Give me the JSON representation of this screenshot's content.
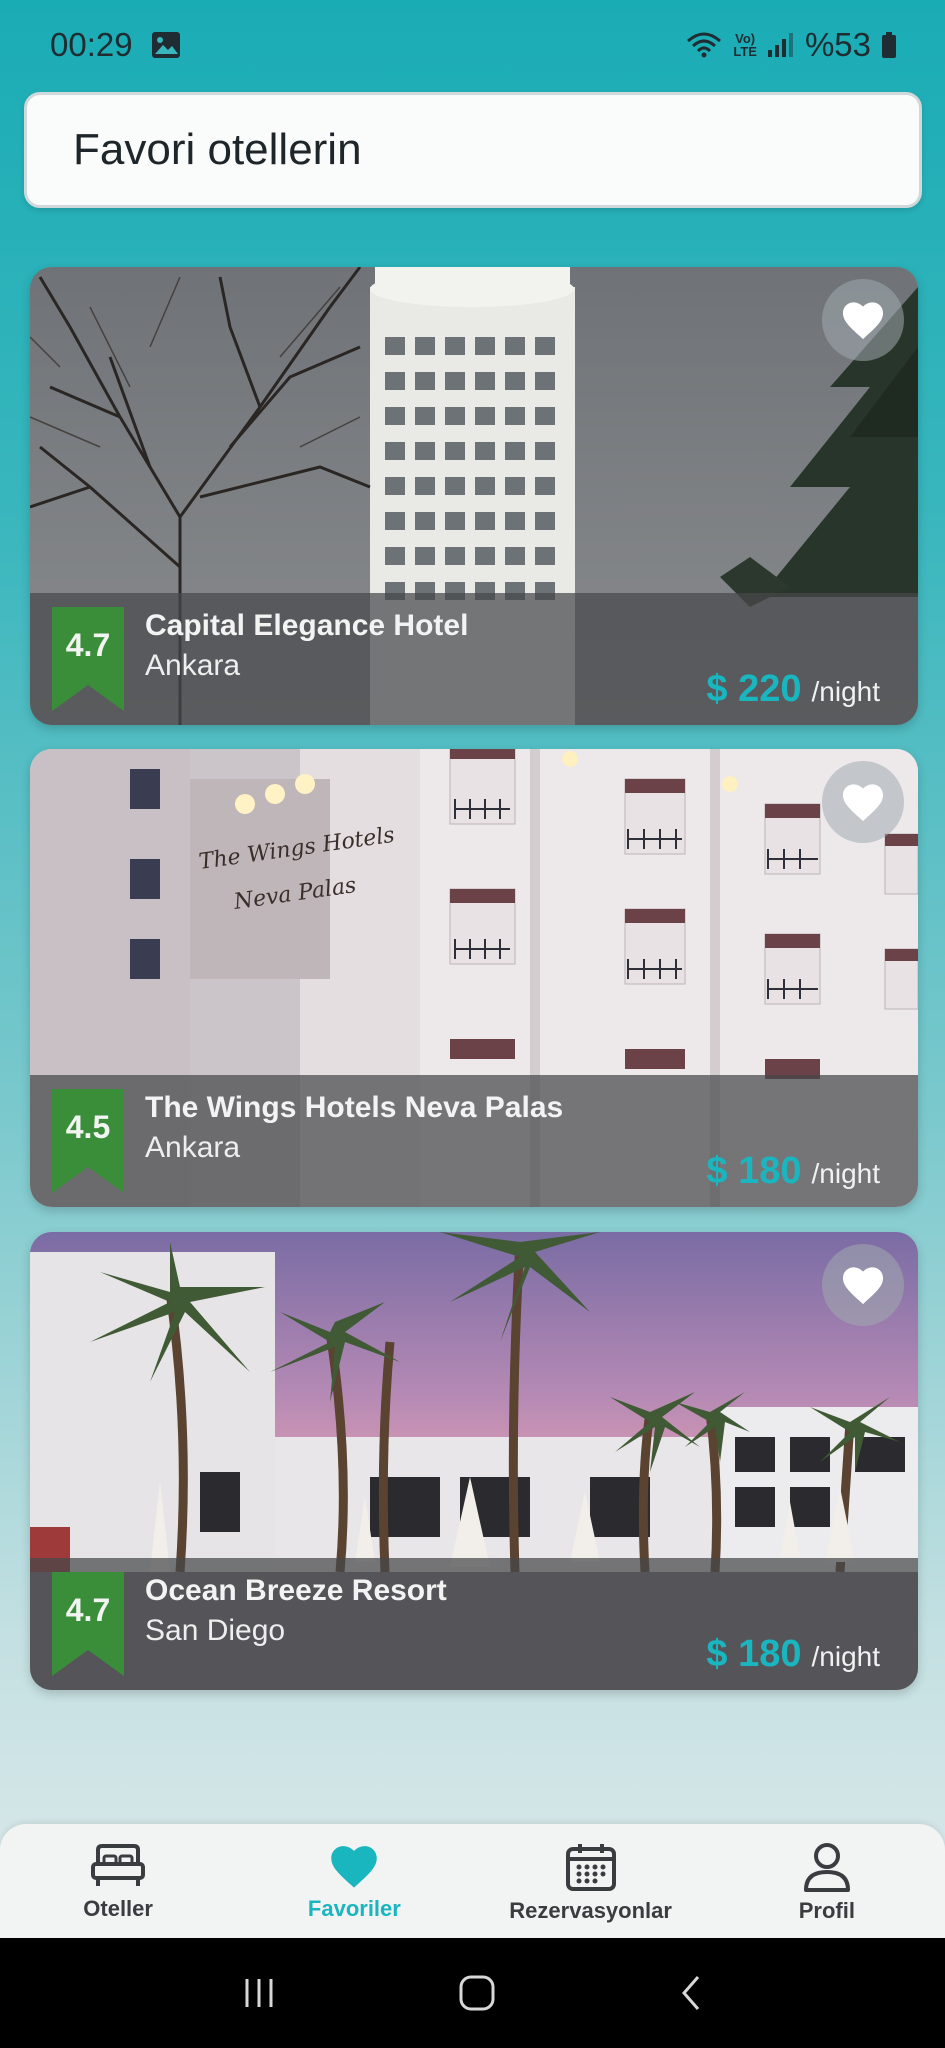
{
  "status_bar": {
    "time": "00:29",
    "battery": "%53",
    "lte_top": "Vo)",
    "lte_bottom": "LTE"
  },
  "header": {
    "title": "Favori otellerin"
  },
  "hotels": [
    {
      "rating": "4.7",
      "name": "Capital Elegance Hotel",
      "city": "Ankara",
      "price": "$ 220",
      "unit": "/night",
      "favorited": true
    },
    {
      "rating": "4.5",
      "name": "The Wings Hotels Neva Palas",
      "city": "Ankara",
      "price": "$ 180",
      "unit": "/night",
      "favorited": true
    },
    {
      "rating": "4.7",
      "name": "Ocean Breeze Resort",
      "city": "San Diego",
      "price": "$ 180",
      "unit": "/night",
      "favorited": true
    }
  ],
  "bottom_nav": {
    "items": [
      {
        "label": "Oteller",
        "icon": "bed-icon",
        "active": false
      },
      {
        "label": "Favoriler",
        "icon": "heart-icon",
        "active": true
      },
      {
        "label": "Rezervasyonlar",
        "icon": "calendar-icon",
        "active": false
      },
      {
        "label": "Profil",
        "icon": "person-icon",
        "active": false
      }
    ]
  },
  "colors": {
    "accent": "#1ab6c0",
    "rating_green": "#3a8e3a",
    "nav_inactive": "#3a3d40"
  }
}
